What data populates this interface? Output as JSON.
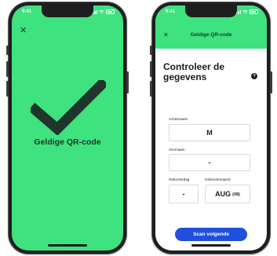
{
  "left_phone": {
    "status": {
      "time": "9:41"
    },
    "result_title": "Geldige QR-code",
    "colors": {
      "screen_bg": "#3ee27f",
      "check": "#20352c"
    }
  },
  "right_phone": {
    "status": {
      "time": "9:41"
    },
    "header": {
      "title": "Geldige QR-code",
      "bg": "#3ee27f"
    },
    "page_title_line1": "Controleer de",
    "page_title_line2": "gegevens",
    "help_icon_glyph": "?",
    "fields": {
      "lastname": {
        "label": "Achternaam",
        "value": "M"
      },
      "firstname": {
        "label": "Voornaam",
        "value": "-"
      },
      "birthday": {
        "label": "Geboortedag",
        "value": "-"
      },
      "birthmonth": {
        "label": "Geboortemaand",
        "value": "AUG",
        "sub": "(08)"
      }
    },
    "scan_button": {
      "label": "Scan volgende",
      "color": "#1f4fdc"
    }
  }
}
